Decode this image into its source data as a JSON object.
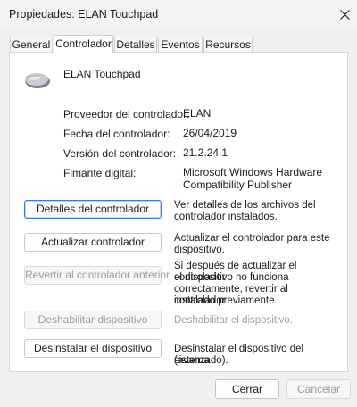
{
  "window": {
    "title": "Propiedades: ELAN Touchpad"
  },
  "tabs": [
    {
      "label": "General"
    },
    {
      "label": "Controlador"
    },
    {
      "label": "Detalles"
    },
    {
      "label": "Eventos"
    },
    {
      "label": "Recursos"
    }
  ],
  "active_tab": "Controlador",
  "device": {
    "name": "ELAN Touchpad",
    "icon": "touchpad-mouse-icon"
  },
  "info": [
    {
      "label": "Proveedor del controlador:",
      "value": "ELAN"
    },
    {
      "label": "Fecha del controlador:",
      "value": "26/04/2019"
    },
    {
      "label": "Versión del controlador:",
      "value": "21.2.24.1"
    },
    {
      "label": "Fimante digital:",
      "value_line1": "Microsoft Windows Hardware",
      "value_line2": "Compatibility Publisher"
    }
  ],
  "actions": [
    {
      "label": "Detalles del controlador",
      "desc1": "Ver detalles de los archivos del",
      "desc2": "controlador instalados.",
      "enabled": true
    },
    {
      "label": "Actualizar controlador",
      "desc1": "Actualizar el controlador para este",
      "desc2": "dispositivo.",
      "enabled": true
    },
    {
      "label": "Revertir al controlador anterior",
      "desc1": "Si después de actualizar el controlador",
      "desc2": "el dispositivo no funciona",
      "desc3": "correctamente, revertir al controlador",
      "desc4": "instalado previamente.",
      "enabled": false
    },
    {
      "label": "Deshabilitar dispositivo",
      "desc1": "Deshabilitar el dispositivo.",
      "enabled": false
    },
    {
      "label": "Desinstalar el dispositivo",
      "desc1": "Desinstalar el dispositivo del sistema",
      "desc2": "(avanzado).",
      "enabled": true
    }
  ],
  "footer": {
    "ok_label": "Cerrar",
    "cancel_label": "Cancelar"
  },
  "colors": {
    "accent": "#3b7bd6",
    "disabled_text": "#9c9c9c",
    "window_bg": "#f0f0f0",
    "panel_bg": "#ffffff"
  }
}
